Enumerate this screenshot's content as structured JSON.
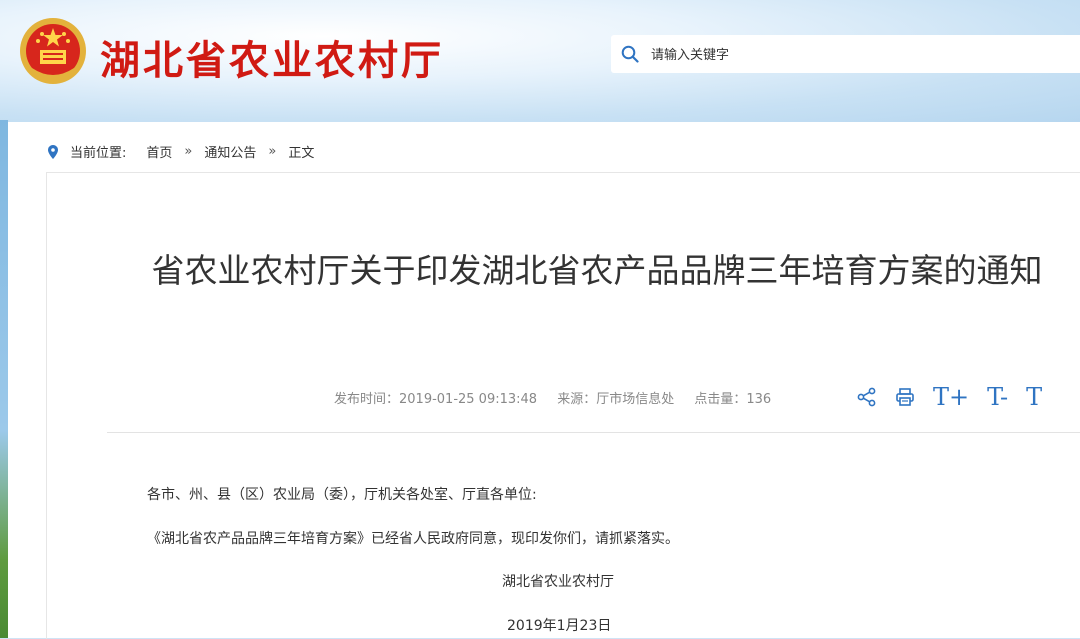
{
  "header": {
    "site_title": "湖北省农业农村厅",
    "search": {
      "placeholder": "请输入关键字",
      "value": ""
    }
  },
  "breadcrumb": {
    "label": "当前位置:",
    "items": [
      "首页",
      "通知公告",
      "正文"
    ],
    "separator": "»"
  },
  "article": {
    "title": "省农业农村厅关于印发湖北省农产品品牌三年培育方案的通知",
    "meta": {
      "publish_time": "发布时间：2019-01-25 09:13:48",
      "source": "来源：厅市场信息处",
      "clicks": "点击量：136"
    },
    "tools": {
      "font_large": "T+",
      "font_small": "T-",
      "font_default": "T"
    },
    "body": {
      "salutation": "各市、州、县（区）农业局（委），厅机关各处室、厅直各单位:",
      "paragraph": "《湖北省农产品品牌三年培育方案》已经省人民政府同意，现印发你们，请抓紧落实。",
      "signature": "湖北省农业农村厅",
      "date": "2019年1月23日"
    }
  },
  "colors": {
    "brand_red": "#d01a13",
    "link_blue": "#2f74c2",
    "text": "#333333",
    "meta": "#888888"
  },
  "icons": [
    "national-emblem-icon",
    "search-icon",
    "location-pin-icon",
    "share-icon",
    "print-icon"
  ]
}
